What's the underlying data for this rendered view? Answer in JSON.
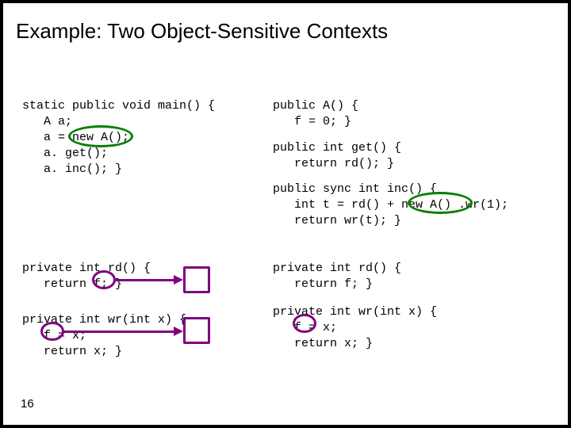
{
  "title": "Example: Two Object-Sensitive Contexts",
  "slide_number": "16",
  "code": {
    "main": "static public void main() {\n   A a;\n   a = new A();\n   a. get();\n   a. inc(); }",
    "rightA": "public A() {\n   f = 0; }",
    "rightGet": "public int get() {\n   return rd(); }",
    "rightInc": "public sync int inc() {\n   int t = rd() + new A() .wr(1);\n   return wr(t); }",
    "leftRd": "private int rd() {\n   return f; }",
    "leftWr": "private int wr(int x) {\n   f = x;\n   return x; }",
    "rightRd": "private int rd() {\n   return f; }",
    "rightWr": "private int wr(int x) {\n   f = x;\n   return x; }"
  },
  "colors": {
    "green": "#008000",
    "purple": "#800080"
  }
}
